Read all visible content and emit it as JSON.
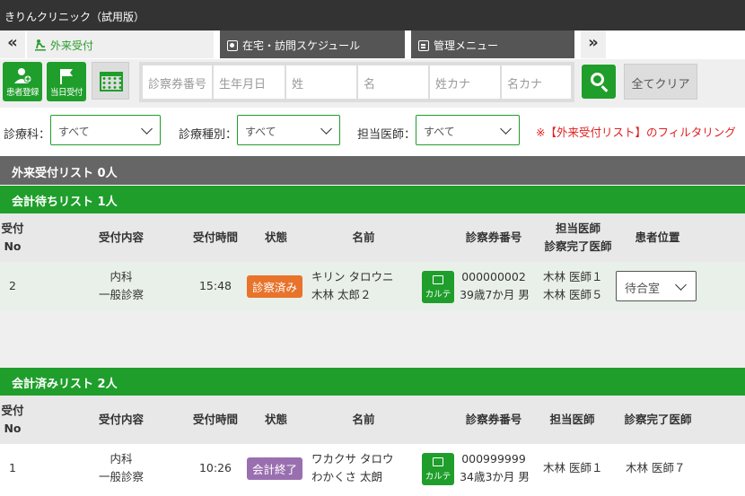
{
  "app": {
    "title": "きりんクリニック（試用版）"
  },
  "tabs": {
    "back": "«",
    "outpatient": "外来受付",
    "home_schedule": "在宅・訪問スケジュール",
    "admin_menu": "管理メニュー",
    "forward": "»"
  },
  "toolbar": {
    "register_label": "患者登録",
    "today_label": "当日受付",
    "calendar_icon": "calendar-icon"
  },
  "search": {
    "card_no": "診察券番号",
    "birthdate": "生年月日",
    "last_name": "姓",
    "first_name": "名",
    "last_kana": "姓カナ",
    "first_kana": "名カナ",
    "clear_label": "全てクリア"
  },
  "filters": {
    "dept_label": "診療科：",
    "dept_value": "すべて",
    "type_label": "診療種別：",
    "type_value": "すべて",
    "doctor_label": "担当医師：",
    "doctor_value": "すべて",
    "note": "※【外来受付リスト】のフィルタリング"
  },
  "sections": {
    "outpatient": "外来受付リスト  0人",
    "waiting": "会計待ちリスト  1人",
    "paid": "会計済みリスト  2人"
  },
  "waiting_header": {
    "no_1": "受付",
    "no_2": "No",
    "content": "受付内容",
    "time": "受付時間",
    "status": "状態",
    "name": "名前",
    "card": "診察券番号",
    "doctor_1": "担当医師",
    "doctor_2": "診察完了医師",
    "position": "患者位置"
  },
  "waiting_rows": [
    {
      "no": "2",
      "dept": "内科",
      "kind": "一般診察",
      "time": "15:48",
      "status": "診察済み",
      "kana": "キリン タロウニ",
      "name": "木林 太郎２",
      "karte": "カルテ",
      "card_no": "000000002",
      "age_sex": "39歳7か月 男",
      "doctor": "木林 医師１",
      "done_doctor": "木林 医師５",
      "position": "待合室"
    }
  ],
  "paid_header": {
    "no_1": "受付",
    "no_2": "No",
    "content": "受付内容",
    "time": "受付時間",
    "status": "状態",
    "name": "名前",
    "card": "診察券番号",
    "doctor": "担当医師",
    "done_doctor": "診察完了医師"
  },
  "paid_rows": [
    {
      "no": "1",
      "dept": "内科",
      "kind": "一般診察",
      "time": "10:26",
      "status": "会計終了",
      "kana": "ワカクサ タロウ",
      "name": "わかくさ 太朗",
      "karte": "カルテ",
      "card_no": "000999999",
      "age_sex": "34歳3か月 男",
      "doctor": "木林 医師１",
      "done_doctor": "木林 医師７"
    }
  ],
  "colors": {
    "accent_green": "#1f9e2b",
    "status_done": "#e8732b",
    "status_paid": "#9a6fb0",
    "note_red": "#e02020"
  }
}
